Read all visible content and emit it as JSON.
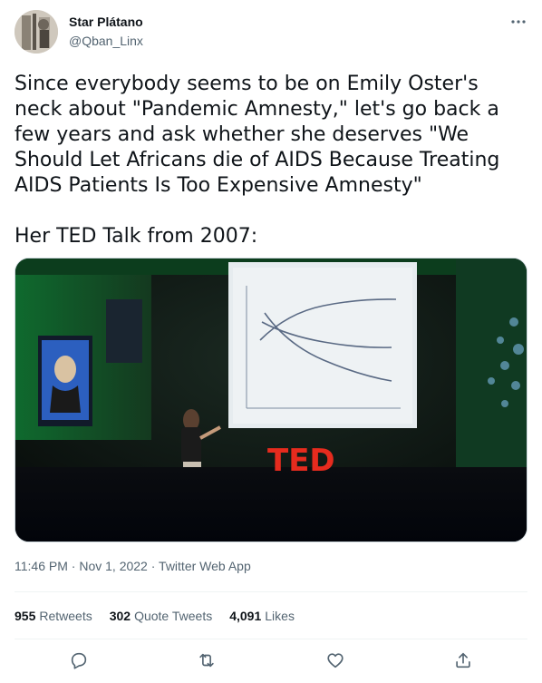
{
  "author": {
    "display_name": "Star Plátano",
    "handle": "@Qban_Linx"
  },
  "tweet": {
    "text": "Since everybody seems to be on Emily Oster's neck about \"Pandemic Amnesty,\" let's go back a few years and ask whether she deserves \"We Should Let Africans die of AIDS Because Treating AIDS Patients Is Too Expensive Amnesty\"\n\nHer TED Talk from 2007:",
    "media": {
      "type": "video",
      "stage_logo": "TED"
    },
    "time": "11:46 PM",
    "date": "Nov 1, 2022",
    "source": "Twitter Web App",
    "separator": " · "
  },
  "stats": {
    "retweets_count": "955",
    "retweets_label": "Retweets",
    "quotes_count": "302",
    "quotes_label": "Quote Tweets",
    "likes_count": "4,091",
    "likes_label": "Likes"
  },
  "icons": {
    "more": "more-icon",
    "reply": "reply-icon",
    "retweet": "retweet-icon",
    "like": "like-icon",
    "share": "share-icon"
  },
  "colors": {
    "text": "#0f1419",
    "secondary": "#536471",
    "border": "#eff3f4",
    "ted_red": "#e62b1e"
  }
}
